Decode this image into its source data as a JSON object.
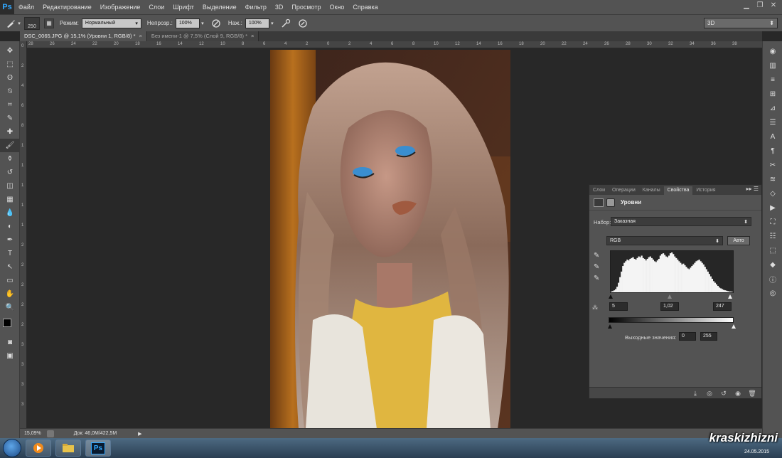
{
  "app": {
    "logo": "Ps"
  },
  "menu": [
    "Файл",
    "Редактирование",
    "Изображение",
    "Слои",
    "Шрифт",
    "Выделение",
    "Фильтр",
    "3D",
    "Просмотр",
    "Окно",
    "Справка"
  ],
  "window_controls": {
    "minimize": "▁",
    "restore": "❐",
    "close": "✕"
  },
  "options": {
    "brush_size": "250",
    "mode_label": "Режим:",
    "mode_value": "Нормальный",
    "opacity_label": "Непрозр.:",
    "opacity_value": "100%",
    "pressure_label": "Наж.:",
    "pressure_value": "100%",
    "workspace": "3D"
  },
  "tabs": [
    {
      "label": "DSC_0065.JPG @ 15,1% (Уровни 1, RGB/8) *",
      "close": "×"
    },
    {
      "label": "Без имени-1 @ 7,5% (Слой 9, RGB/8) *",
      "close": "×"
    }
  ],
  "ruler_top": [
    "28",
    "26",
    "24",
    "22",
    "20",
    "18",
    "16",
    "14",
    "12",
    "10",
    "8",
    "6",
    "4",
    "2",
    "0",
    "2",
    "4",
    "6",
    "8",
    "10",
    "12",
    "14",
    "16",
    "18",
    "20",
    "22",
    "24",
    "26",
    "28",
    "30",
    "32",
    "34",
    "36",
    "38"
  ],
  "ruler_left": [
    "0",
    "2",
    "4",
    "6",
    "8",
    "1",
    "1",
    "1",
    "1",
    "1",
    "2",
    "2",
    "2",
    "2",
    "2",
    "3",
    "3",
    "3",
    "3"
  ],
  "tools": [
    "move-tool-icon",
    "marquee-tool-icon",
    "lasso-tool-icon",
    "quick-select-tool-icon",
    "crop-tool-icon",
    "eyedropper-tool-icon",
    "healing-tool-icon",
    "brush-tool-icon",
    "stamp-tool-icon",
    "history-brush-tool-icon",
    "eraser-tool-icon",
    "gradient-tool-icon",
    "blur-tool-icon",
    "dodge-tool-icon",
    "pen-tool-icon",
    "type-tool-icon",
    "path-select-tool-icon",
    "shape-tool-icon",
    "hand-tool-icon",
    "zoom-tool-icon"
  ],
  "tool_glyphs": [
    "✥",
    "⬚",
    "ʘ",
    "⍉",
    "⌗",
    "✎",
    "✚",
    "🖌",
    "⚱",
    "↺",
    "◫",
    "▦",
    "💧",
    "◐",
    "✒",
    "T",
    "↖",
    "▭",
    "✋",
    "🔍"
  ],
  "right_tools": [
    "◉",
    "▥",
    "≡",
    "⊞",
    "⊿",
    "☰",
    "A",
    "¶",
    "✂",
    "≋",
    "◇",
    "▶",
    "⛶",
    "☷",
    "⬚",
    "◆",
    "ⓘ",
    "◎"
  ],
  "panel": {
    "tabs": [
      "Слои",
      "Операции",
      "Каналы",
      "Свойства",
      "История"
    ],
    "active_tab": 3,
    "menu": "▸▸ ☰",
    "title": "Уровни",
    "preset_label": "Набор:",
    "preset_value": "Заказная",
    "channel": "RGB",
    "auto": "Авто",
    "input_black": "5",
    "input_gamma": "1,02",
    "input_white": "247",
    "output_label": "Выходные значения:",
    "output_black": "0",
    "output_white": "255"
  },
  "histogram": [
    2,
    3,
    5,
    8,
    14,
    24,
    38,
    52,
    66,
    74,
    78,
    82,
    80,
    84,
    86,
    88,
    84,
    82,
    86,
    90,
    88,
    92,
    86,
    84,
    80,
    84,
    88,
    90,
    86,
    82,
    78,
    76,
    80,
    84,
    92,
    96,
    98,
    94,
    90,
    88,
    92,
    98,
    100,
    96,
    90,
    86,
    82,
    78,
    74,
    70,
    72,
    68,
    64,
    60,
    58,
    62,
    66,
    70,
    74,
    78,
    80,
    82,
    78,
    74,
    70,
    64,
    58,
    52,
    46,
    40,
    34,
    28,
    24,
    20,
    16,
    12,
    10,
    8,
    6,
    5,
    4,
    3,
    2,
    2,
    1
  ],
  "status": {
    "zoom": "15,09%",
    "doc": "Док: 46,0M/422,5M"
  },
  "watermark": "kraskizhizni",
  "date": "24.05.2015"
}
